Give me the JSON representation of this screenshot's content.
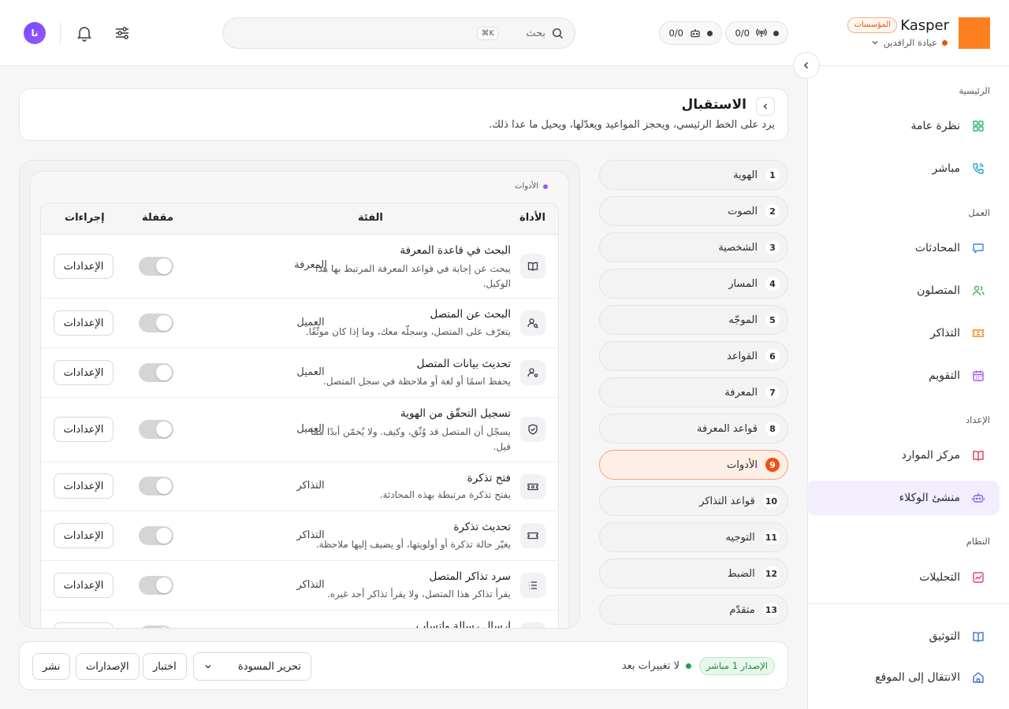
{
  "brand": {
    "name": "Kasper",
    "badge": "المؤسسات",
    "org": "عيادة الرافدين",
    "logo_color": "#fe7f1f"
  },
  "topbar": {
    "chip_agents": "0/0",
    "chip_live": "0/0",
    "search_placeholder": "بحث",
    "search_shortcut": "⌘K",
    "avatar_initials": "نا"
  },
  "sidebar": {
    "sections": [
      "الرئيسية",
      "العمل",
      "الإعداد",
      "النظام"
    ],
    "items": [
      {
        "label": "نظرة عامة",
        "icon": "grid-icon",
        "color": "#2bb673"
      },
      {
        "label": "مباشر",
        "icon": "phone-icon",
        "color": "#1aa3c8"
      },
      {
        "label": "المحادثات",
        "icon": "chat-icon",
        "color": "#3b82f6"
      },
      {
        "label": "المتصلون",
        "icon": "users-icon",
        "color": "#4caf50"
      },
      {
        "label": "التذاكر",
        "icon": "ticket-icon",
        "color": "#f08a24"
      },
      {
        "label": "التقويم",
        "icon": "calendar-icon",
        "color": "#a855f7"
      },
      {
        "label": "مركز الموارد",
        "icon": "book-icon",
        "color": "#e23d55"
      },
      {
        "label": "منشئ الوكلاء",
        "icon": "robot-icon",
        "color": "#8b5cf6"
      },
      {
        "label": "التحليلات",
        "icon": "chart-icon",
        "color": "#e23d8a"
      }
    ],
    "footer_items": [
      {
        "label": "التوثيق",
        "icon": "docs-icon"
      },
      {
        "label": "الانتقال إلى الموقع",
        "icon": "home-icon"
      }
    ]
  },
  "header": {
    "title": "الاستقبال",
    "description": "يرد على الخط الرئيسي، ويحجز المواعيد ويعدّلها، ويحيل ما عدا ذلك."
  },
  "steps": [
    {
      "num": "1",
      "label": "الهوية"
    },
    {
      "num": "2",
      "label": "الصوت"
    },
    {
      "num": "3",
      "label": "الشخصية"
    },
    {
      "num": "4",
      "label": "المسار"
    },
    {
      "num": "5",
      "label": "الموجّه"
    },
    {
      "num": "6",
      "label": "القواعد"
    },
    {
      "num": "7",
      "label": "المعرفة"
    },
    {
      "num": "8",
      "label": "قواعد المعرفة"
    },
    {
      "num": "9",
      "label": "الأدوات"
    },
    {
      "num": "10",
      "label": "قواعد التذاكر"
    },
    {
      "num": "11",
      "label": "التوجيه"
    },
    {
      "num": "12",
      "label": "الضبط"
    },
    {
      "num": "13",
      "label": "متقدّم"
    }
  ],
  "tools": {
    "label": "الأدوات",
    "columns": {
      "tool": "الأداة",
      "category": "الفئة",
      "locked": "مقفلة",
      "actions": "إجراءات"
    },
    "settings_label": "الإعدادات",
    "rows": [
      {
        "name": "البحث في قاعدة المعرفة",
        "desc": "يبحث عن إجابة في قواعد المعرفة المرتبط بها هذا الوكيل.",
        "category": "المعرفة",
        "icon": "book-open-icon"
      },
      {
        "name": "البحث عن المتصل",
        "desc": "يتعرّف على المتصل، وسجلّه معك، وما إذا كان موثّقًا.",
        "category": "العميل",
        "icon": "user-search-icon"
      },
      {
        "name": "تحديث بيانات المتصل",
        "desc": "يحفظ اسمًا أو لغة أو ملاحظة في سجل المتصل.",
        "category": "العميل",
        "icon": "user-edit-icon"
      },
      {
        "name": "تسجيل التحقّق من الهوية",
        "desc": "يسجّل أن المتصل قد وُثّق، وكيف. ولا يُخمّن أبدًا مما قيل.",
        "category": "العميل",
        "icon": "shield-icon"
      },
      {
        "name": "فتح تذكرة",
        "desc": "يفتح تذكرة مرتبطة بهذه المحادثة.",
        "category": "التذاكر",
        "icon": "ticket-icon"
      },
      {
        "name": "تحديث تذكرة",
        "desc": "يغيّر حالة تذكرة أو أولويتها، أو يضيف إليها ملاحظة.",
        "category": "التذاكر",
        "icon": "ticket-icon"
      },
      {
        "name": "سرد تذاكر المتصل",
        "desc": "يقرأ تذاكر هذا المتصل، ولا يقرأ تذاكر أحد غيره.",
        "category": "التذاكر",
        "icon": "list-icon"
      },
      {
        "name": "ارسال رسالة واتساب",
        "desc": "",
        "category": "",
        "icon": "message-icon"
      }
    ]
  },
  "footer": {
    "live_badge": "الإصدار 1 مباشر",
    "status": "لا تغييرات بعد",
    "select_value": "تحرير المسودة",
    "test_label": "اختبار",
    "versions_label": "الإصدارات",
    "publish_label": "نشر"
  }
}
